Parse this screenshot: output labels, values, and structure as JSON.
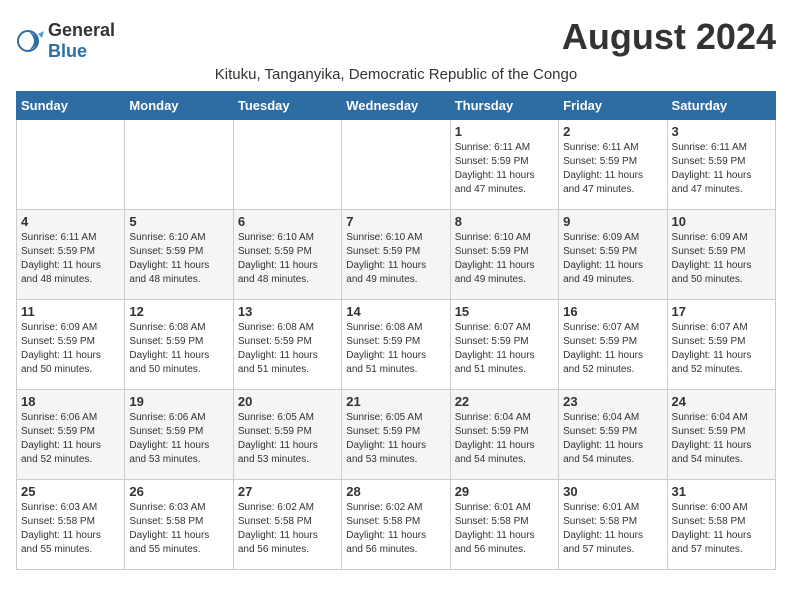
{
  "header": {
    "logo_general": "General",
    "logo_blue": "Blue",
    "month_title": "August 2024",
    "location": "Kituku, Tanganyika, Democratic Republic of the Congo"
  },
  "calendar": {
    "days_of_week": [
      "Sunday",
      "Monday",
      "Tuesday",
      "Wednesday",
      "Thursday",
      "Friday",
      "Saturday"
    ],
    "weeks": [
      [
        {
          "day": "",
          "info": ""
        },
        {
          "day": "",
          "info": ""
        },
        {
          "day": "",
          "info": ""
        },
        {
          "day": "",
          "info": ""
        },
        {
          "day": "1",
          "info": "Sunrise: 6:11 AM\nSunset: 5:59 PM\nDaylight: 11 hours\nand 47 minutes."
        },
        {
          "day": "2",
          "info": "Sunrise: 6:11 AM\nSunset: 5:59 PM\nDaylight: 11 hours\nand 47 minutes."
        },
        {
          "day": "3",
          "info": "Sunrise: 6:11 AM\nSunset: 5:59 PM\nDaylight: 11 hours\nand 47 minutes."
        }
      ],
      [
        {
          "day": "4",
          "info": "Sunrise: 6:11 AM\nSunset: 5:59 PM\nDaylight: 11 hours\nand 48 minutes."
        },
        {
          "day": "5",
          "info": "Sunrise: 6:10 AM\nSunset: 5:59 PM\nDaylight: 11 hours\nand 48 minutes."
        },
        {
          "day": "6",
          "info": "Sunrise: 6:10 AM\nSunset: 5:59 PM\nDaylight: 11 hours\nand 48 minutes."
        },
        {
          "day": "7",
          "info": "Sunrise: 6:10 AM\nSunset: 5:59 PM\nDaylight: 11 hours\nand 49 minutes."
        },
        {
          "day": "8",
          "info": "Sunrise: 6:10 AM\nSunset: 5:59 PM\nDaylight: 11 hours\nand 49 minutes."
        },
        {
          "day": "9",
          "info": "Sunrise: 6:09 AM\nSunset: 5:59 PM\nDaylight: 11 hours\nand 49 minutes."
        },
        {
          "day": "10",
          "info": "Sunrise: 6:09 AM\nSunset: 5:59 PM\nDaylight: 11 hours\nand 50 minutes."
        }
      ],
      [
        {
          "day": "11",
          "info": "Sunrise: 6:09 AM\nSunset: 5:59 PM\nDaylight: 11 hours\nand 50 minutes."
        },
        {
          "day": "12",
          "info": "Sunrise: 6:08 AM\nSunset: 5:59 PM\nDaylight: 11 hours\nand 50 minutes."
        },
        {
          "day": "13",
          "info": "Sunrise: 6:08 AM\nSunset: 5:59 PM\nDaylight: 11 hours\nand 51 minutes."
        },
        {
          "day": "14",
          "info": "Sunrise: 6:08 AM\nSunset: 5:59 PM\nDaylight: 11 hours\nand 51 minutes."
        },
        {
          "day": "15",
          "info": "Sunrise: 6:07 AM\nSunset: 5:59 PM\nDaylight: 11 hours\nand 51 minutes."
        },
        {
          "day": "16",
          "info": "Sunrise: 6:07 AM\nSunset: 5:59 PM\nDaylight: 11 hours\nand 52 minutes."
        },
        {
          "day": "17",
          "info": "Sunrise: 6:07 AM\nSunset: 5:59 PM\nDaylight: 11 hours\nand 52 minutes."
        }
      ],
      [
        {
          "day": "18",
          "info": "Sunrise: 6:06 AM\nSunset: 5:59 PM\nDaylight: 11 hours\nand 52 minutes."
        },
        {
          "day": "19",
          "info": "Sunrise: 6:06 AM\nSunset: 5:59 PM\nDaylight: 11 hours\nand 53 minutes."
        },
        {
          "day": "20",
          "info": "Sunrise: 6:05 AM\nSunset: 5:59 PM\nDaylight: 11 hours\nand 53 minutes."
        },
        {
          "day": "21",
          "info": "Sunrise: 6:05 AM\nSunset: 5:59 PM\nDaylight: 11 hours\nand 53 minutes."
        },
        {
          "day": "22",
          "info": "Sunrise: 6:04 AM\nSunset: 5:59 PM\nDaylight: 11 hours\nand 54 minutes."
        },
        {
          "day": "23",
          "info": "Sunrise: 6:04 AM\nSunset: 5:59 PM\nDaylight: 11 hours\nand 54 minutes."
        },
        {
          "day": "24",
          "info": "Sunrise: 6:04 AM\nSunset: 5:59 PM\nDaylight: 11 hours\nand 54 minutes."
        }
      ],
      [
        {
          "day": "25",
          "info": "Sunrise: 6:03 AM\nSunset: 5:58 PM\nDaylight: 11 hours\nand 55 minutes."
        },
        {
          "day": "26",
          "info": "Sunrise: 6:03 AM\nSunset: 5:58 PM\nDaylight: 11 hours\nand 55 minutes."
        },
        {
          "day": "27",
          "info": "Sunrise: 6:02 AM\nSunset: 5:58 PM\nDaylight: 11 hours\nand 56 minutes."
        },
        {
          "day": "28",
          "info": "Sunrise: 6:02 AM\nSunset: 5:58 PM\nDaylight: 11 hours\nand 56 minutes."
        },
        {
          "day": "29",
          "info": "Sunrise: 6:01 AM\nSunset: 5:58 PM\nDaylight: 11 hours\nand 56 minutes."
        },
        {
          "day": "30",
          "info": "Sunrise: 6:01 AM\nSunset: 5:58 PM\nDaylight: 11 hours\nand 57 minutes."
        },
        {
          "day": "31",
          "info": "Sunrise: 6:00 AM\nSunset: 5:58 PM\nDaylight: 11 hours\nand 57 minutes."
        }
      ]
    ]
  }
}
